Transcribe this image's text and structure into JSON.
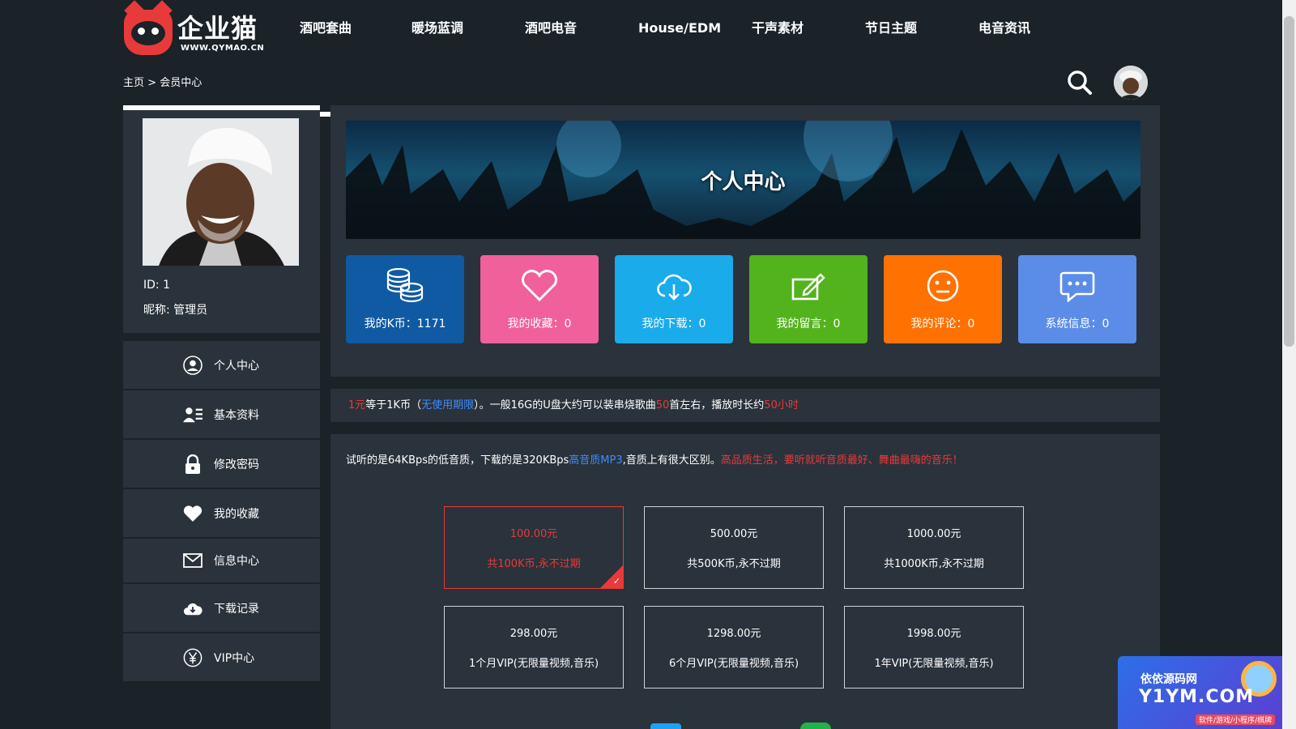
{
  "header": {
    "logo_name": "企业猫",
    "logo_url": "WWW.QYMAO.CN",
    "nav": [
      "酒吧套曲",
      "暖场蓝调",
      "酒吧电音",
      "House/EDM",
      "干声素材",
      "节日主题",
      "电音资讯"
    ]
  },
  "breadcrumb": {
    "home": "主页",
    "separator": ">",
    "current": "会员中心"
  },
  "profile": {
    "id": "ID: 1",
    "nickname": "昵称: 管理员"
  },
  "menu": [
    {
      "label": "个人中心",
      "icon": "user-circle-icon"
    },
    {
      "label": "基本资料",
      "icon": "id-card-icon"
    },
    {
      "label": "修改密码",
      "icon": "lock-icon"
    },
    {
      "label": "我的收藏",
      "icon": "heart-icon"
    },
    {
      "label": "信息中心",
      "icon": "envelope-icon"
    },
    {
      "label": "下载记录",
      "icon": "cloud-download-icon"
    },
    {
      "label": "VIP中心",
      "icon": "yen-circle-icon"
    }
  ],
  "banner": {
    "title": "个人中心"
  },
  "stats": [
    {
      "label": "我的K币：1171",
      "color": "#0f5aa3",
      "icon": "coins-icon"
    },
    {
      "label": "我的收藏：0",
      "color": "#f0609a",
      "icon": "heart-outline-icon"
    },
    {
      "label": "我的下载：0",
      "color": "#1aabeb",
      "icon": "cloud-download-icon"
    },
    {
      "label": "我的留言：0",
      "color": "#53b31c",
      "icon": "edit-icon"
    },
    {
      "label": "我的评论：0",
      "color": "#ff7100",
      "icon": "smile-icon"
    },
    {
      "label": "系统信息：0",
      "color": "#5b8de8",
      "icon": "chat-bubble-icon"
    }
  ],
  "info": {
    "p1": "1元",
    "p2": "等于1K币（",
    "p3": "无使用期限",
    "p4": "）。一般16G的U盘大约可以装串烧歌曲",
    "p5": "50",
    "p6": "首左右，播放时长约",
    "p7": "50小时"
  },
  "note": {
    "n1": "试听的是64KBps的低音质，下载的是320KBps",
    "n2": "高音质MP3",
    "n3": ",音质上有很大区别。",
    "n4": "高品质生活，要听就听音质最好、舞曲最嗨的音乐！"
  },
  "plans": [
    {
      "price": "100.00元",
      "desc": "共100K币,永不过期",
      "selected": true
    },
    {
      "price": "500.00元",
      "desc": "共500K币,永不过期",
      "selected": false
    },
    {
      "price": "1000.00元",
      "desc": "共1000K币,永不过期",
      "selected": false
    },
    {
      "price": "298.00元",
      "desc": "1个月VIP(无限量视频,音乐)",
      "selected": false
    },
    {
      "price": "1298.00元",
      "desc": "6个月VIP(无限量视频,音乐)",
      "selected": false
    },
    {
      "price": "1998.00元",
      "desc": "1年VIP(无限量视频,音乐)",
      "selected": false
    }
  ],
  "watermark": {
    "line1": "依依源码网",
    "line2": "Y1YM.COM",
    "line3": "软件/游戏/小程序/棋牌"
  },
  "colors": {
    "bg": "#1b2228",
    "panel": "#2a323b",
    "accent": "#e83a3a",
    "link": "#3e8dff"
  }
}
